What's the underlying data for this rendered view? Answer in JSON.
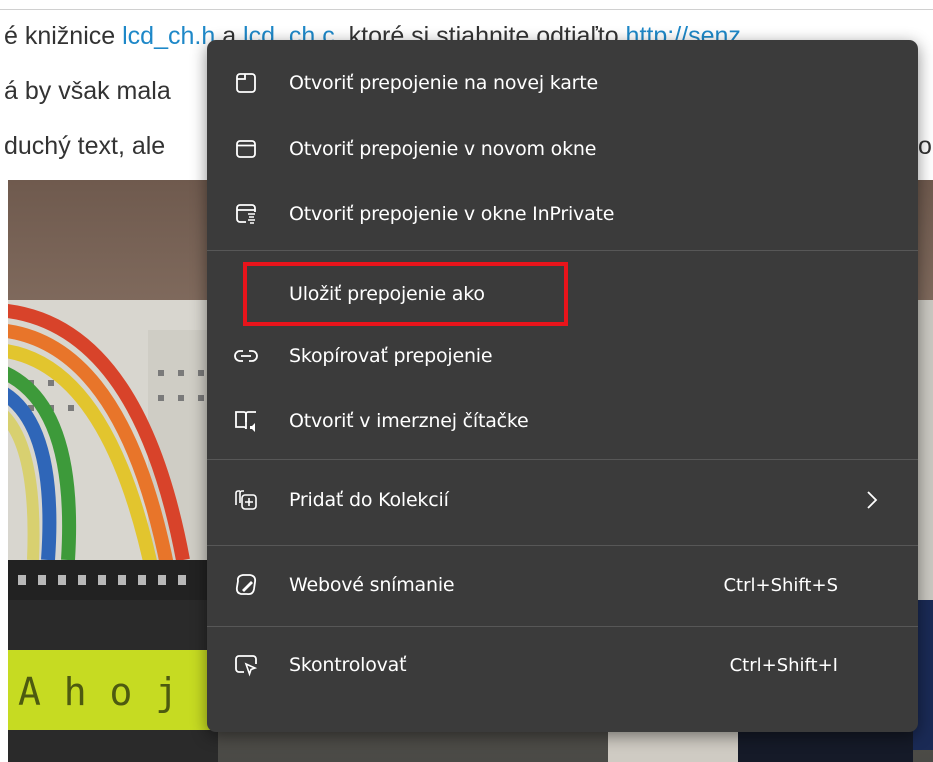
{
  "background": {
    "line1": {
      "pre": "é knižnice ",
      "link1": "lcd_ch.h",
      "mid": " a ",
      "link2": "lcd_ch.c",
      "post": ", ktoré si stiahnite odtiaľto ",
      "link3": "http://senz"
    },
    "line2": "á by však mala",
    "line3": "duchý text, ale",
    "line3_right": "ol"
  },
  "menu": {
    "items": [
      {
        "label": "Otvoriť prepojenie na novej karte",
        "icon": "new-tab-icon"
      },
      {
        "label": "Otvoriť prepojenie v novom okne",
        "icon": "new-window-icon"
      },
      {
        "label": "Otvoriť prepojenie v okne InPrivate",
        "icon": "inprivate-icon"
      },
      {
        "label": "Uložiť prepojenie ako",
        "icon": ""
      },
      {
        "label": "Skopírovať prepojenie",
        "icon": "link-icon"
      },
      {
        "label": "Otvoriť v imerznej čítačke",
        "icon": "immersive-reader-icon"
      },
      {
        "label": "Pridať do Kolekcií",
        "icon": "add-to-collections-icon"
      },
      {
        "label": "Webové snímanie",
        "icon": "web-capture-icon",
        "shortcut": "Ctrl+Shift+S"
      },
      {
        "label": "Skontrolovať",
        "icon": "inspect-icon",
        "shortcut": "Ctrl+Shift+I"
      }
    ],
    "accent": "#e8141b"
  }
}
